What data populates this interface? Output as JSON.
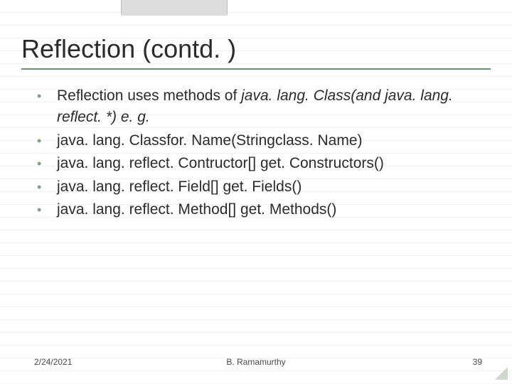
{
  "title": "Reflection (contd. )",
  "bullets": [
    {
      "plain": "Reflection uses methods of ",
      "italic": "java. lang. Class(and java. lang. reflect. *) e. g."
    },
    {
      "plain": "java. lang. Classfor. Name(Stringclass. Name)",
      "italic": ""
    },
    {
      "plain": "java. lang. reflect. Contructor[] get. Constructors()",
      "italic": ""
    },
    {
      "plain": "java. lang. reflect. Field[] get. Fields()",
      "italic": ""
    },
    {
      "plain": "java. lang. reflect. Method[] get. Methods()",
      "italic": ""
    }
  ],
  "footer": {
    "date": "2/24/2021",
    "author": "B. Ramamurthy",
    "page": "39"
  }
}
